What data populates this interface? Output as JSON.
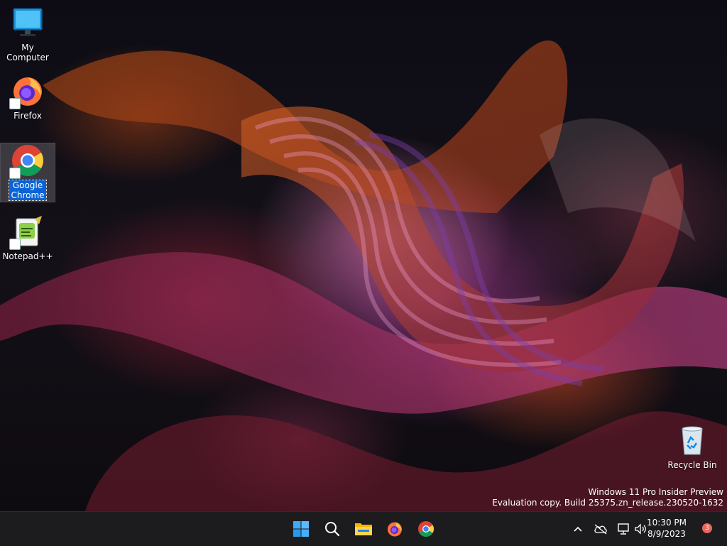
{
  "desktop": {
    "icons": [
      {
        "label": "My Computer"
      },
      {
        "label": "Firefox"
      },
      {
        "label": "Google Chrome"
      },
      {
        "label": "Notepad++"
      },
      {
        "label": "Recycle Bin"
      }
    ]
  },
  "watermark": {
    "line1": "Windows 11 Pro Insider Preview",
    "line2": "Evaluation copy. Build 25375.zn_release.230520-1632"
  },
  "taskbar": {
    "pinned": [
      {
        "icon": "windows-start-icon"
      },
      {
        "icon": "search-icon"
      },
      {
        "icon": "file-explorer-icon"
      },
      {
        "icon": "firefox-icon"
      },
      {
        "icon": "chrome-icon"
      }
    ],
    "tray": {
      "icons": [
        "chevron-up-icon",
        "cloud-offline-icon",
        "network-icon",
        "volume-icon"
      ],
      "time": "10:30 PM",
      "date": "8/9/2023",
      "notification_count": "3"
    }
  },
  "colors": {
    "taskbar_bg": "#1c1c1f",
    "selection_blue": "#0a64d6",
    "notification_badge": "#e8685c"
  }
}
